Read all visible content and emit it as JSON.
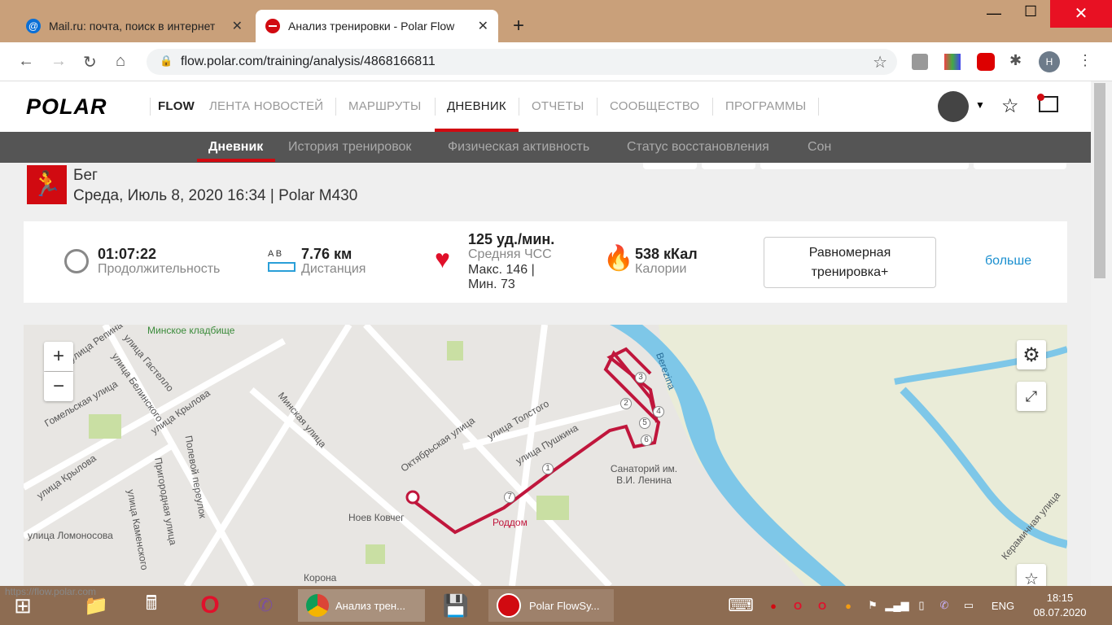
{
  "browser": {
    "tabs": [
      {
        "title": "Mail.ru: почта, поиск в интернет"
      },
      {
        "title": "Анализ тренировки - Polar Flow"
      }
    ],
    "new_tab": "+",
    "url": "flow.polar.com/training/analysis/4868166811",
    "profile_initial": "H",
    "status_url": "https://flow.polar.com"
  },
  "header": {
    "logo": "POLAR",
    "flow": "FLOW",
    "nav": [
      "ЛЕНТА НОВОСТЕЙ",
      "МАРШРУТЫ",
      "ДНЕВНИК",
      "ОТЧЕТЫ",
      "СООБЩЕСТВО",
      "ПРОГРАММЫ"
    ],
    "active_nav": "ДНЕВНИК"
  },
  "subnav": {
    "items": [
      "Дневник",
      "История тренировок",
      "Физическая активность",
      "Статус восстановления",
      "Сон"
    ],
    "active": "Дневник"
  },
  "session": {
    "sport": "Бег",
    "datetime": "Среда, Июль 8, 2020 16:34 | Polar M430"
  },
  "summary": {
    "duration": {
      "value": "01:07:22",
      "label": "Продолжительность"
    },
    "distance": {
      "ab": "A  B",
      "value": "7.76 км",
      "label": "Дистанция"
    },
    "hr": {
      "value": "125 уд./мин.",
      "label": "Средняя ЧСС",
      "max": "Макс. 146  |",
      "min": "Мин. 73"
    },
    "calories": {
      "value": "538 кКал",
      "label": "Калории"
    },
    "benefit": "Равномерная тренировка+",
    "more": "больше"
  },
  "map": {
    "zoom_in": "+",
    "zoom_out": "−",
    "labels": [
      "Минское кладбище",
      "улица Репина",
      "улица Гастелло",
      "улица Белинского",
      "Гомельская улица",
      "улица Крылова",
      "улица Крылова",
      "Минская улица",
      "Полевой переулок",
      "Пригородная улица",
      "улица Каменского",
      "улица Ломоносова",
      "Октябрьская улица",
      "улица Толстого",
      "улица Пушкина",
      "Ноев Ковчег",
      "Роддом",
      "Санаторий им. В.И. Ленина",
      "Корона",
      "Berezina",
      "Керамичная улица"
    ],
    "markers": [
      "1",
      "2",
      "3",
      "4",
      "5",
      "6",
      "7"
    ]
  },
  "taskbar": {
    "chrome_task": "Анализ трен...",
    "polar_task": "Polar FlowSy...",
    "lang": "ENG",
    "time": "18:15",
    "date": "08.07.2020"
  }
}
